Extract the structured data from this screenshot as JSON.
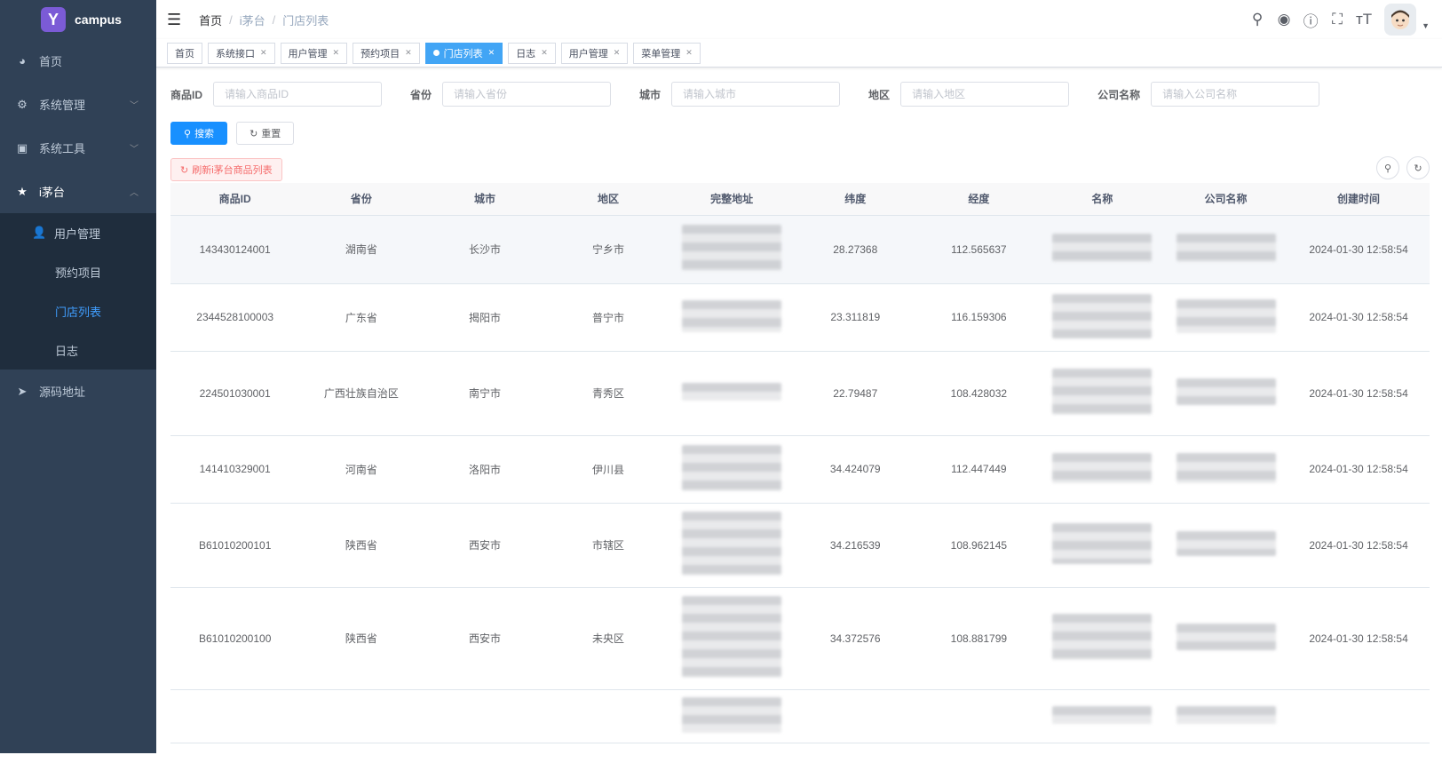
{
  "app": {
    "logo_text": "campus"
  },
  "sidebar": {
    "items": [
      {
        "label": "首页",
        "icon": "dashboard-icon"
      },
      {
        "label": "系统管理",
        "icon": "gear-icon",
        "expandable": true
      },
      {
        "label": "系统工具",
        "icon": "toolbox-icon",
        "expandable": true
      },
      {
        "label": "i茅台",
        "icon": "star-icon",
        "expandable": true,
        "expanded": true
      },
      {
        "label": "源码地址",
        "icon": "send-icon"
      }
    ],
    "submenu": [
      {
        "label": "用户管理",
        "icon": "user-icon"
      },
      {
        "label": "预约项目"
      },
      {
        "label": "门店列表",
        "active": true
      },
      {
        "label": "日志"
      }
    ]
  },
  "navbar": {
    "breadcrumb": [
      "首页",
      "i茅台",
      "门店列表"
    ]
  },
  "tags": [
    {
      "label": "首页",
      "closable": false
    },
    {
      "label": "系统接口",
      "closable": true
    },
    {
      "label": "用户管理",
      "closable": true
    },
    {
      "label": "预约项目",
      "closable": true
    },
    {
      "label": "门店列表",
      "closable": true,
      "active": true
    },
    {
      "label": "日志",
      "closable": true
    },
    {
      "label": "用户管理",
      "closable": true
    },
    {
      "label": "菜单管理",
      "closable": true
    }
  ],
  "filters": [
    {
      "label": "商品ID",
      "placeholder": "请输入商品ID"
    },
    {
      "label": "省份",
      "placeholder": "请输入省份"
    },
    {
      "label": "城市",
      "placeholder": "请输入城市"
    },
    {
      "label": "地区",
      "placeholder": "请输入地区"
    },
    {
      "label": "公司名称",
      "placeholder": "请输入公司名称"
    }
  ],
  "buttons": {
    "search": "搜索",
    "reset": "重置",
    "refresh": "刷新i茅台商品列表"
  },
  "table": {
    "columns": [
      "商品ID",
      "省份",
      "城市",
      "地区",
      "完整地址",
      "纬度",
      "经度",
      "名称",
      "公司名称",
      "创建时间"
    ],
    "rows": [
      {
        "id": "143430124001",
        "province": "湖南省",
        "city": "长沙市",
        "district": "宁乡市",
        "lat": "28.27368",
        "lng": "112.565637",
        "created": "2024-01-30 12:58:54"
      },
      {
        "id": "2344528100003",
        "province": "广东省",
        "city": "揭阳市",
        "district": "普宁市",
        "lat": "23.311819",
        "lng": "116.159306",
        "created": "2024-01-30 12:58:54"
      },
      {
        "id": "224501030001",
        "province": "广西壮族自治区",
        "city": "南宁市",
        "district": "青秀区",
        "lat": "22.79487",
        "lng": "108.428032",
        "created": "2024-01-30 12:58:54"
      },
      {
        "id": "141410329001",
        "province": "河南省",
        "city": "洛阳市",
        "district": "伊川县",
        "lat": "34.424079",
        "lng": "112.447449",
        "created": "2024-01-30 12:58:54"
      },
      {
        "id": "B61010200101",
        "province": "陕西省",
        "city": "西安市",
        "district": "市辖区",
        "lat": "34.216539",
        "lng": "108.962145",
        "created": "2024-01-30 12:58:54"
      },
      {
        "id": "B61010200100",
        "province": "陕西省",
        "city": "西安市",
        "district": "未央区",
        "lat": "34.372576",
        "lng": "108.881799",
        "created": "2024-01-30 12:58:54"
      },
      {
        "id": "",
        "province": "",
        "city": "",
        "district": "",
        "lat": "",
        "lng": "",
        "created": ""
      }
    ]
  }
}
